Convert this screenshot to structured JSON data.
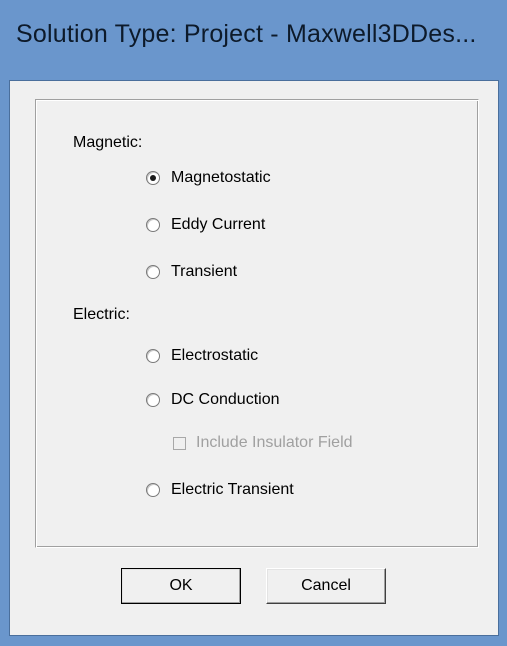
{
  "window": {
    "title": "Solution Type: Project - Maxwell3DDes..."
  },
  "magnetic": {
    "label": "Magnetic:",
    "options": [
      {
        "label": "Magnetostatic",
        "checked": true
      },
      {
        "label": "Eddy Current",
        "checked": false
      },
      {
        "label": "Transient",
        "checked": false
      }
    ]
  },
  "electric": {
    "label": "Electric:",
    "options": [
      {
        "label": "Electrostatic",
        "checked": false
      },
      {
        "label": "DC Conduction",
        "checked": false
      },
      {
        "label": "Electric Transient",
        "checked": false
      }
    ],
    "include_insulator": {
      "label": "Include Insulator Field",
      "checked": false,
      "enabled": false
    }
  },
  "buttons": {
    "ok": "OK",
    "cancel": "Cancel"
  }
}
